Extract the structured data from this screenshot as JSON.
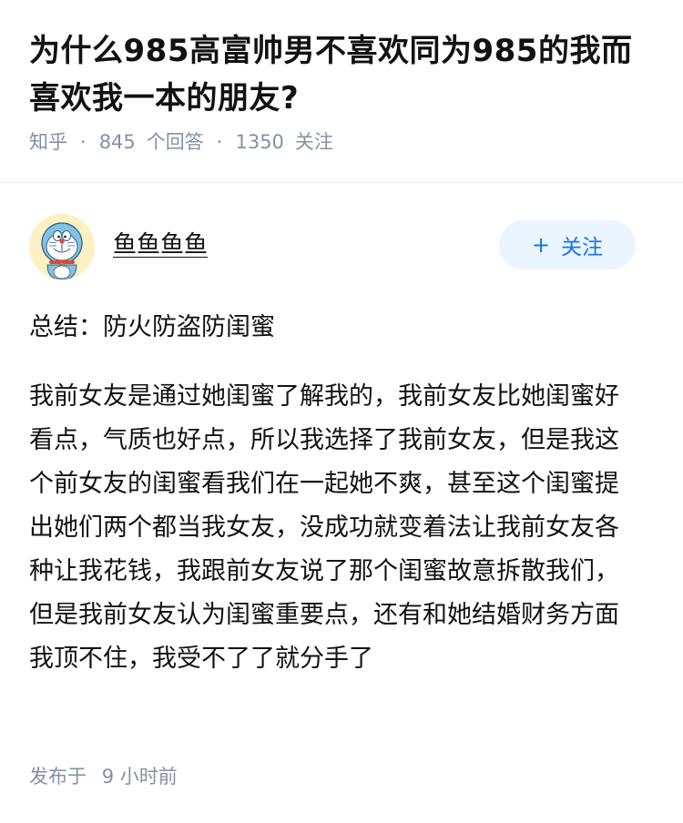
{
  "question": {
    "title": "为什么985高富帅男不喜欢同为985的我而喜欢我一本的朋友?",
    "meta": {
      "source": "知乎",
      "separator": "·",
      "answers_count": "845",
      "answers_label": "个回答",
      "followers_count": "1350",
      "followers_label": "关注"
    }
  },
  "author": {
    "name": "鱼鱼鱼鱼",
    "avatar_icon": "cartoon-cat-avatar",
    "follow_button": {
      "icon": "plus-icon",
      "icon_glyph": "+",
      "label": "关注"
    }
  },
  "answer": {
    "summary": "总结：防火防盗防闺蜜",
    "paragraph": "我前女友是通过她闺蜜了解我的，我前女友比她闺蜜好看点，气质也好点，所以我选择了我前女友，但是我这个前女友的闺蜜看我们在一起她不爽，甚至这个闺蜜提出她们两个都当我女友，没成功就变着法让我前女友各种让我花钱，我跟前女友说了那个闺蜜故意拆散我们，但是我前女友认为闺蜜重要点，还有和她结婚财务方面我顶不住，我受不了了就分手了",
    "footer": {
      "published_label": "发布于",
      "published_time": "9 小时前"
    }
  },
  "colors": {
    "meta_gray": "#8590a6",
    "accent_blue": "#1772f6",
    "follow_bg": "#ebf5ff",
    "text": "#121212"
  }
}
